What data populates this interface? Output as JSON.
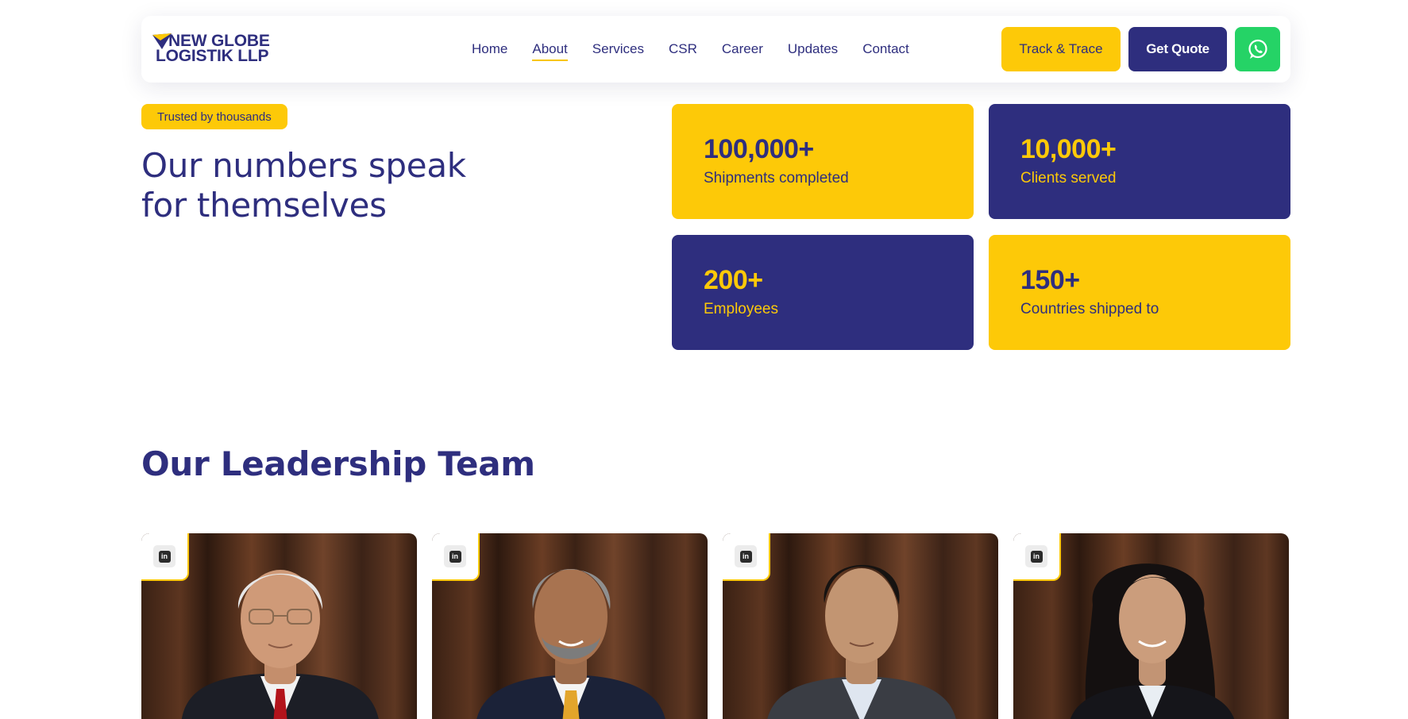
{
  "header": {
    "logo": {
      "line1": "NEW GLOBE",
      "line2": "LOGISTIK LLP"
    },
    "nav": [
      {
        "label": "Home",
        "active": false
      },
      {
        "label": "About",
        "active": true
      },
      {
        "label": "Services",
        "active": false
      },
      {
        "label": "CSR",
        "active": false
      },
      {
        "label": "Career",
        "active": false
      },
      {
        "label": "Updates",
        "active": false
      },
      {
        "label": "Contact",
        "active": false
      }
    ],
    "track_button": "Track & Trace",
    "quote_button": "Get Quote",
    "whatsapp_icon": "whatsapp-icon"
  },
  "stats": {
    "badge": "Trusted by thousands",
    "title_line1": "Our numbers speak",
    "title_line2": "for themselves",
    "items": [
      {
        "value": "100,000+",
        "label": "Shipments completed",
        "theme": "yellow"
      },
      {
        "value": "10,000+",
        "label": "Clients served",
        "theme": "navy"
      },
      {
        "value": "200+",
        "label": "Employees",
        "theme": "navy"
      },
      {
        "value": "150+",
        "label": "Countries shipped to",
        "theme": "yellow"
      }
    ]
  },
  "leadership": {
    "title": "Our Leadership Team",
    "members": [
      {
        "linkedin_icon": "linkedin-icon",
        "linkedin_text": "in"
      },
      {
        "linkedin_icon": "linkedin-icon",
        "linkedin_text": "in"
      },
      {
        "linkedin_icon": "linkedin-icon",
        "linkedin_text": "in"
      },
      {
        "linkedin_icon": "linkedin-icon",
        "linkedin_text": "in"
      }
    ]
  },
  "colors": {
    "navy": "#2e2e7e",
    "yellow": "#fdc908",
    "whatsapp": "#25d366"
  }
}
